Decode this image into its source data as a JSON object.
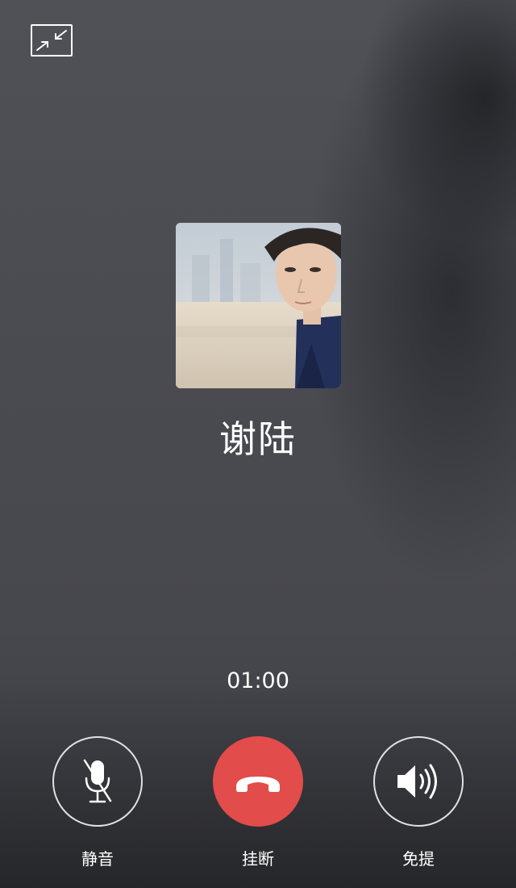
{
  "call": {
    "caller_name": "谢陆",
    "duration": "01:00"
  },
  "controls": {
    "mute_label": "静音",
    "hangup_label": "挂断",
    "speaker_label": "免提"
  },
  "icons": {
    "minimize": "minimize-window-icon",
    "mute": "microphone-off-icon",
    "hangup": "phone-hangup-icon",
    "speaker": "speaker-icon"
  },
  "colors": {
    "hangup": "#e24c4b",
    "background": "#4b4c52",
    "text": "#ffffff"
  }
}
